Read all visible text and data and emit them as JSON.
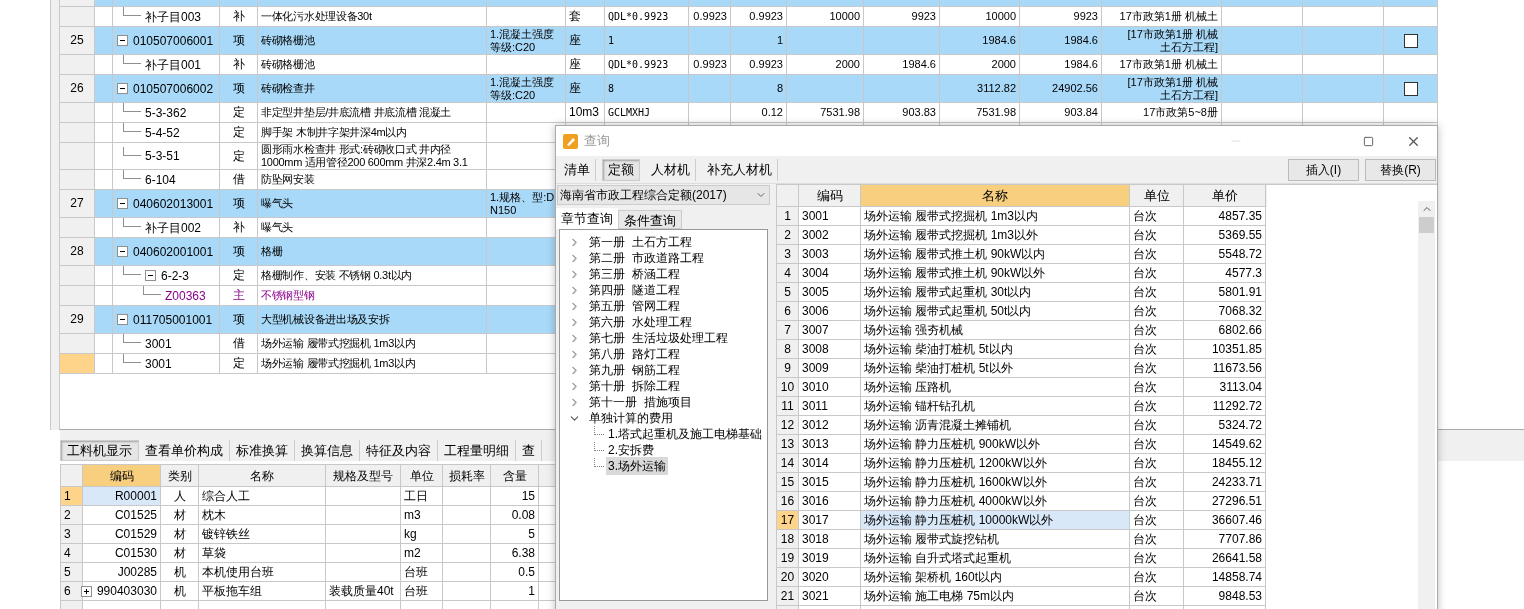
{
  "main_table": {
    "rows": [
      {
        "kind": "item",
        "selected": false,
        "children": [
          {
            "kind": "sub",
            "code": "补子目003",
            "type": "补",
            "name": "一体化污水处理设备30t",
            "unit": "套",
            "expr": "QDL*0.9923",
            "factor": "0.9923",
            "qty": "0.9923",
            "price": "10000",
            "total": "9923",
            "price2": "10000",
            "total2": "9923",
            "specialty": "17市政第1册  机械土",
            "selected": false
          }
        ]
      },
      {
        "kind": "item",
        "number": "25",
        "code": "010507006001",
        "type": "项",
        "name": "砖砌格栅池",
        "feature": "1.混凝土强度等级:C20",
        "unit": "座",
        "expr": "1",
        "qty": "1",
        "price2": "1984.6",
        "total2": "1984.6",
        "specialty": "[17市政第1册  机械土石方工程]",
        "checked": false,
        "expanded": true,
        "selected": false,
        "children": [
          {
            "kind": "sub",
            "code": "补子目001",
            "type": "补",
            "name": "砖砌格栅池",
            "unit": "座",
            "expr": "QDL*0.9923",
            "factor": "0.9923",
            "qty": "0.9923",
            "price": "2000",
            "total": "1984.6",
            "price2": "2000",
            "total2": "1984.6",
            "specialty": "17市政第1册  机械土",
            "selected": false
          }
        ]
      },
      {
        "kind": "item",
        "number": "26",
        "code": "010507006002",
        "type": "项",
        "name": "砖砌检查井",
        "feature": "1.混凝土强度等级:C20",
        "unit": "座",
        "expr": "8",
        "qty": "8",
        "price2": "3112.82",
        "total2": "24902.56",
        "specialty": "[17市政第1册  机械土石方工程]",
        "checked": false,
        "expanded": true,
        "selected": false,
        "children": [
          {
            "kind": "sub",
            "code": "5-3-362",
            "type": "定",
            "name": "非定型井垫层/井底流槽 井底流槽 混凝土",
            "unit": "10m3",
            "expr": "GCLMXHJ",
            "qty": "0.12",
            "price": "7531.98",
            "total": "903.83",
            "price2": "7531.98",
            "total2": "903.84",
            "specialty": "17市政第5~8册",
            "selected": false
          },
          {
            "kind": "sub",
            "code": "5-4-52",
            "type": "定",
            "name": "脚手架 木制井字架井深4m以内",
            "selected": false
          },
          {
            "kind": "sub",
            "code": "5-3-51",
            "type": "定",
            "name": "圆形雨水检查井 形式:砖砌收口式 井内径1000mm 适用管径200 600mm 井深2.4m 3.1",
            "selected": false
          },
          {
            "kind": "sub",
            "code": "6-104",
            "type": "借",
            "name": "防坠网安装",
            "selected": false
          }
        ]
      },
      {
        "kind": "item",
        "number": "27",
        "code": "040602013001",
        "type": "项",
        "name": "曝气头",
        "feature": "1.规格、型:DN150",
        "expanded": true,
        "selected": false,
        "children": [
          {
            "kind": "sub",
            "code": "补子目002",
            "type": "补",
            "name": "曝气头",
            "selected": false
          }
        ]
      },
      {
        "kind": "item",
        "number": "28",
        "code": "040602001001",
        "type": "项",
        "name": "格栅",
        "expanded": true,
        "selected": false,
        "children": [
          {
            "kind": "sub",
            "code": "6-2-3",
            "type": "定",
            "name": "格栅制作、安装 不锈钢 0.3t以内",
            "expanded": true,
            "selected": false,
            "children": [
              {
                "kind": "material",
                "code": "Z00363",
                "type": "主",
                "name": "不锈钢型钢",
                "selected": false
              }
            ]
          }
        ]
      },
      {
        "kind": "item",
        "number": "29",
        "code": "011705001001",
        "type": "项",
        "name": "大型机械设备进出场及安拆",
        "expanded": true,
        "selected": false,
        "children": [
          {
            "kind": "sub",
            "code": "3001",
            "type": "借",
            "name": "场外运输 履带式挖掘机 1m3以内",
            "selected": false
          },
          {
            "kind": "sub",
            "code": "3001",
            "type": "定",
            "name": "场外运输 履带式挖掘机 1m3以内",
            "selected": true
          }
        ]
      }
    ]
  },
  "detail_tabs": [
    {
      "label": "工料机显示",
      "selected": true
    },
    {
      "label": "查看单价构成",
      "selected": false
    },
    {
      "label": "标准换算",
      "selected": false
    },
    {
      "label": "换算信息",
      "selected": false
    },
    {
      "label": "特征及内容",
      "selected": false
    },
    {
      "label": "工程量明细",
      "selected": false
    },
    {
      "label": "查",
      "selected": false
    }
  ],
  "resource_table": {
    "columns": [
      {
        "label": "编码",
        "current": true
      },
      {
        "label": "类别",
        "current": false
      },
      {
        "label": "名称",
        "current": false
      },
      {
        "label": "规格及型号",
        "current": false
      },
      {
        "label": "单位",
        "current": false
      },
      {
        "label": "损耗率",
        "current": false
      },
      {
        "label": "含量",
        "current": false
      }
    ],
    "rows": [
      {
        "number": "1",
        "code": "R00001",
        "category": "人",
        "name": "综合人工",
        "unit": "工日",
        "amount": "15",
        "selected": true
      },
      {
        "number": "2",
        "code": "C01525",
        "category": "材",
        "name": "枕木",
        "unit": "m3",
        "amount": "0.08",
        "selected": false
      },
      {
        "number": "3",
        "code": "C01529",
        "category": "材",
        "name": "镀锌铁丝",
        "unit": "kg",
        "amount": "5",
        "selected": false
      },
      {
        "number": "4",
        "code": "C01530",
        "category": "材",
        "name": "草袋",
        "unit": "m2",
        "amount": "6.38",
        "selected": false
      },
      {
        "number": "5",
        "code": "J00285",
        "category": "机",
        "name": "本机使用台班",
        "unit": "台班",
        "amount": "0.5",
        "selected": false
      },
      {
        "number": "6",
        "code": "990403030",
        "category": "机",
        "name": "平板拖车组",
        "spec": "装载质量40t",
        "unit": "台班",
        "amount": "1",
        "expanded": false,
        "selected": false
      }
    ]
  },
  "query_dialog": {
    "title": "查询",
    "tabs": [
      {
        "label": "清单",
        "selected": false
      },
      {
        "label": "定额",
        "selected": true
      },
      {
        "label": "人材机",
        "selected": false
      },
      {
        "label": "补充人材机",
        "selected": false
      }
    ],
    "buttons": [
      "插入(I)",
      "替换(R)"
    ],
    "library": "海南省市政工程综合定额(2017)",
    "search_tabs": [
      {
        "label": "章节查询",
        "selected": true
      },
      {
        "label": "条件查询",
        "selected": false
      }
    ],
    "tree": [
      {
        "label": "第一册  土石方工程",
        "expanded": false,
        "selected": false
      },
      {
        "label": "第二册  市政道路工程",
        "expanded": false,
        "selected": false
      },
      {
        "label": "第三册  桥涵工程",
        "expanded": false,
        "selected": false
      },
      {
        "label": "第四册  隧道工程",
        "expanded": false,
        "selected": false
      },
      {
        "label": "第五册  管网工程",
        "expanded": false,
        "selected": false
      },
      {
        "label": "第六册  水处理工程",
        "expanded": false,
        "selected": false
      },
      {
        "label": "第七册  生活垃圾处理工程",
        "expanded": false,
        "selected": false
      },
      {
        "label": "第八册  路灯工程",
        "expanded": false,
        "selected": false
      },
      {
        "label": "第九册  钢筋工程",
        "expanded": false,
        "selected": false
      },
      {
        "label": "第十册  拆除工程",
        "expanded": false,
        "selected": false
      },
      {
        "label": "第十一册  措施项目",
        "expanded": false,
        "selected": false
      },
      {
        "label": "单独计算的费用",
        "expanded": true,
        "selected": false,
        "children": [
          {
            "label": "1.塔式起重机及施工电梯基础",
            "selected": false
          },
          {
            "label": "2.安拆费",
            "selected": false
          },
          {
            "label": "3.场外运输",
            "selected": true
          }
        ]
      }
    ],
    "grid": {
      "columns": [
        {
          "label": "编码",
          "current": false
        },
        {
          "label": "名称",
          "current": true
        },
        {
          "label": "单位",
          "current": false
        },
        {
          "label": "单价",
          "current": false
        }
      ],
      "rows": [
        {
          "number": "1",
          "code": "3001",
          "name": "场外运输 履带式挖掘机 1m3以内",
          "unit": "台次",
          "price": "4857.35",
          "selected": false
        },
        {
          "number": "2",
          "code": "3002",
          "name": "场外运输 履带式挖掘机 1m3以外",
          "unit": "台次",
          "price": "5369.55",
          "selected": false
        },
        {
          "number": "3",
          "code": "3003",
          "name": "场外运输 履带式推土机 90kW以内",
          "unit": "台次",
          "price": "5548.72",
          "selected": false
        },
        {
          "number": "4",
          "code": "3004",
          "name": "场外运输 履带式推土机 90kW以外",
          "unit": "台次",
          "price": "4577.3",
          "selected": false
        },
        {
          "number": "5",
          "code": "3005",
          "name": "场外运输 履带式起重机 30t以内",
          "unit": "台次",
          "price": "5801.91",
          "selected": false
        },
        {
          "number": "6",
          "code": "3006",
          "name": "场外运输 履带式起重机 50t以内",
          "unit": "台次",
          "price": "7068.32",
          "selected": false
        },
        {
          "number": "7",
          "code": "3007",
          "name": "场外运输 强夯机械",
          "unit": "台次",
          "price": "6802.66",
          "selected": false
        },
        {
          "number": "8",
          "code": "3008",
          "name": "场外运输 柴油打桩机 5t以内",
          "unit": "台次",
          "price": "10351.85",
          "selected": false
        },
        {
          "number": "9",
          "code": "3009",
          "name": "场外运输 柴油打桩机 5t以外",
          "unit": "台次",
          "price": "11673.56",
          "selected": false
        },
        {
          "number": "10",
          "code": "3010",
          "name": "场外运输 压路机",
          "unit": "台次",
          "price": "3113.04",
          "selected": false
        },
        {
          "number": "11",
          "code": "3011",
          "name": "场外运输 锚杆钻孔机",
          "unit": "台次",
          "price": "11292.72",
          "selected": false
        },
        {
          "number": "12",
          "code": "3012",
          "name": "场外运输 沥青混凝土摊铺机",
          "unit": "台次",
          "price": "5324.72",
          "selected": false
        },
        {
          "number": "13",
          "code": "3013",
          "name": "场外运输 静力压桩机 900kW以外",
          "unit": "台次",
          "price": "14549.62",
          "selected": false
        },
        {
          "number": "14",
          "code": "3014",
          "name": "场外运输 静力压桩机 1200kW以外",
          "unit": "台次",
          "price": "18455.12",
          "selected": false
        },
        {
          "number": "15",
          "code": "3015",
          "name": "场外运输 静力压桩机 1600kW以外",
          "unit": "台次",
          "price": "24233.71",
          "selected": false
        },
        {
          "number": "16",
          "code": "3016",
          "name": "场外运输 静力压桩机 4000kW以外",
          "unit": "台次",
          "price": "27296.51",
          "selected": false
        },
        {
          "number": "17",
          "code": "3017",
          "name": "场外运输 静力压桩机 10000kW以外",
          "unit": "台次",
          "price": "36607.46",
          "selected": true
        },
        {
          "number": "18",
          "code": "3018",
          "name": "场外运输 履带式旋挖钻机",
          "unit": "台次",
          "price": "7707.86",
          "selected": false
        },
        {
          "number": "19",
          "code": "3019",
          "name": "场外运输 自升式塔式起重机",
          "unit": "台次",
          "price": "26641.58",
          "selected": false
        },
        {
          "number": "20",
          "code": "3020",
          "name": "场外运输 架桥机 160t以内",
          "unit": "台次",
          "price": "14858.74",
          "selected": false
        },
        {
          "number": "21",
          "code": "3021",
          "name": "场外运输 施工电梯 75m以内",
          "unit": "台次",
          "price": "9848.53",
          "selected": false
        }
      ]
    }
  }
}
